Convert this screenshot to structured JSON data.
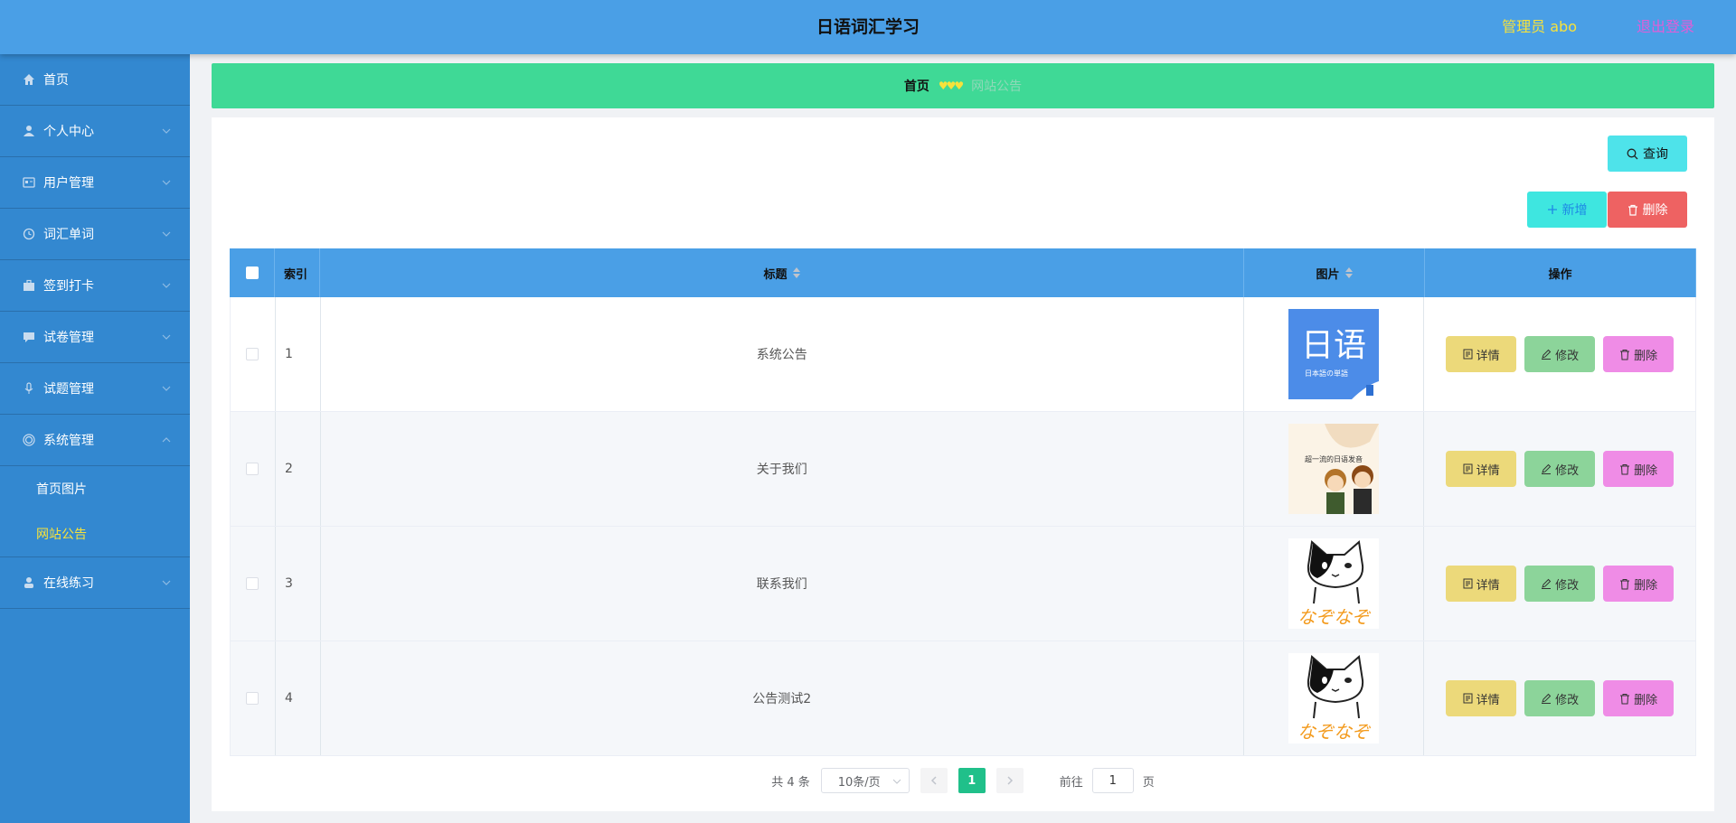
{
  "header": {
    "title": "日语词汇学习",
    "admin": "管理员 abo",
    "logout": "退出登录"
  },
  "sidebar": {
    "items": [
      {
        "label": "首页",
        "icon": "home-icon"
      },
      {
        "label": "个人中心",
        "icon": "user-icon"
      },
      {
        "label": "用户管理",
        "icon": "id-card-icon"
      },
      {
        "label": "词汇单词",
        "icon": "clock-icon"
      },
      {
        "label": "签到打卡",
        "icon": "briefcase-icon"
      },
      {
        "label": "试卷管理",
        "icon": "chat-icon"
      },
      {
        "label": "试题管理",
        "icon": "mic-icon"
      },
      {
        "label": "系统管理",
        "icon": "target-icon"
      },
      {
        "label": "在线练习",
        "icon": "person-icon"
      }
    ],
    "submenu": [
      {
        "label": "首页图片"
      },
      {
        "label": "网站公告"
      }
    ]
  },
  "breadcrumb": {
    "home": "首页",
    "separator": "♥♥♥",
    "current": "网站公告"
  },
  "toolbar": {
    "query": "查询",
    "add": "新增",
    "delete": "删除"
  },
  "table": {
    "headers": {
      "index": "索引",
      "title": "标题",
      "image": "图片",
      "actions": "操作"
    },
    "rows": [
      {
        "index": "1",
        "title": "系统公告"
      },
      {
        "index": "2",
        "title": "关于我们"
      },
      {
        "index": "3",
        "title": "联系我们"
      },
      {
        "index": "4",
        "title": "公告测试2"
      }
    ],
    "row_actions": {
      "detail": "详情",
      "edit": "修改",
      "delete": "删除"
    },
    "thumb1": {
      "big": "日语",
      "small": "日本語の単語"
    },
    "thumb2": {
      "text": "超一流的日语发音"
    },
    "thumb_cat": {
      "text": "なぞなぞ"
    }
  },
  "pagination": {
    "total": "共 4 条",
    "page_size": "10条/页",
    "current": "1",
    "goto_prefix": "前往",
    "goto_value": "1",
    "goto_suffix": "页"
  },
  "colors": {
    "header": "#4a9fe6",
    "sidebar": "#3388d0",
    "breadcrumb": "#3fd996",
    "active_menu": "#f7e23b"
  }
}
